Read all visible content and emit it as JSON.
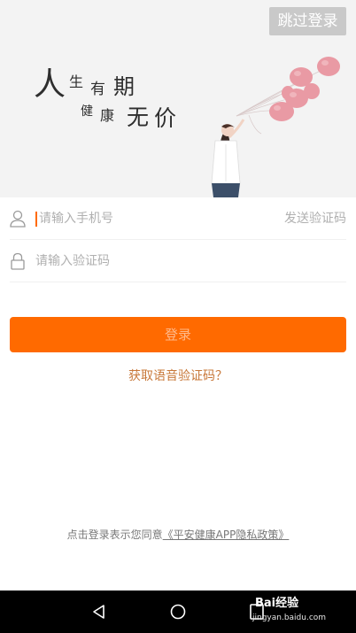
{
  "banner": {
    "skip_label": "跳过登录",
    "slogan": {
      "c1": "人",
      "c2": "生",
      "c3": "有",
      "c4": "期",
      "c5": "健",
      "c6": "康",
      "c7": "无",
      "c8": "价"
    }
  },
  "form": {
    "phone_placeholder": "请输入手机号",
    "send_code_label": "发送验证码",
    "code_placeholder": "请输入验证码"
  },
  "login_label": "登录",
  "voice_code_label": "获取语音验证码？",
  "agreement": {
    "prefix": "点击登录表示您同意",
    "policy_link": "《平安健康APP隐私政策》"
  },
  "watermark": {
    "title": "Bai经验",
    "subtitle": "jingyan.baidu.com"
  },
  "colors": {
    "accent": "#ff6a00",
    "link": "#c8783a"
  }
}
